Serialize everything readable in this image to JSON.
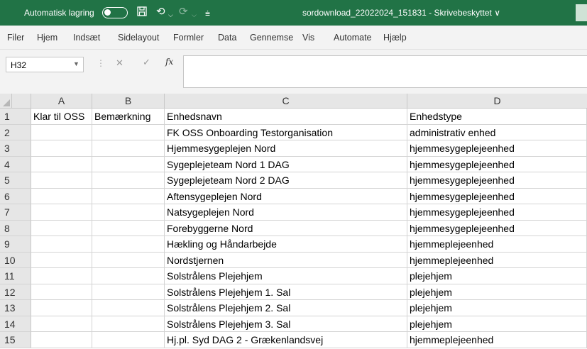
{
  "titlebar": {
    "autosave_label": "Automatisk lagring",
    "doc_title": "sordownload_22022024_151831 - Skrivebeskyttet ∨"
  },
  "menu": [
    "Filer",
    "Hjem",
    "Indsæt",
    "Sidelayout",
    "Formler",
    "Data",
    "Gennemse",
    "Vis",
    "Automate",
    "Hjælp"
  ],
  "formula_bar": {
    "name_box": "H32",
    "fx": "fx",
    "content": ""
  },
  "sheet": {
    "columns": [
      "A",
      "B",
      "C",
      "D"
    ],
    "header_row": [
      "Klar til OSS",
      "Bemærkning",
      "Enhedsnavn",
      "Enhedstype"
    ],
    "rows": [
      {
        "num": "1",
        "a": "Klar til OSS",
        "b": "Bemærkning",
        "c": "Enhedsnavn",
        "d": "Enhedstype"
      },
      {
        "num": "2",
        "a": "",
        "b": "",
        "c": "FK OSS Onboarding Testorganisation",
        "d": "administrativ enhed"
      },
      {
        "num": "3",
        "a": "",
        "b": "",
        "c": "Hjemmesygeplejen Nord",
        "d": "hjemmesygeplejeenhed"
      },
      {
        "num": "4",
        "a": "",
        "b": "",
        "c": "Sygeplejeteam Nord 1 DAG",
        "d": "hjemmesygeplejeenhed"
      },
      {
        "num": "5",
        "a": "",
        "b": "",
        "c": "Sygeplejeteam Nord 2 DAG",
        "d": "hjemmesygeplejeenhed"
      },
      {
        "num": "6",
        "a": "",
        "b": "",
        "c": "Aftensygeplejen Nord",
        "d": "hjemmesygeplejeenhed"
      },
      {
        "num": "7",
        "a": "",
        "b": "",
        "c": "Natsygeplejen Nord",
        "d": "hjemmesygeplejeenhed"
      },
      {
        "num": "8",
        "a": "",
        "b": "",
        "c": "Forebyggerne Nord",
        "d": "hjemmesygeplejeenhed"
      },
      {
        "num": "9",
        "a": "",
        "b": "",
        "c": "Hækling og Håndarbejde",
        "d": "hjemmeplejeenhed"
      },
      {
        "num": "10",
        "a": "",
        "b": "",
        "c": "Nordstjernen",
        "d": "hjemmeplejeenhed"
      },
      {
        "num": "11",
        "a": "",
        "b": "",
        "c": "Solstrålens Plejehjem",
        "d": "plejehjem"
      },
      {
        "num": "12",
        "a": "",
        "b": "",
        "c": "Solstrålens Plejehjem 1. Sal",
        "d": "plejehjem"
      },
      {
        "num": "13",
        "a": "",
        "b": "",
        "c": "Solstrålens Plejehjem 2. Sal",
        "d": "plejehjem"
      },
      {
        "num": "14",
        "a": "",
        "b": "",
        "c": "Solstrålens Plejehjem 3. Sal",
        "d": "plejehjem"
      },
      {
        "num": "15",
        "a": "",
        "b": "",
        "c": "Hj.pl. Syd DAG 2 - Grækenlandsvej",
        "d": "hjemmeplejeenhed"
      }
    ]
  },
  "colors": {
    "excel_green": "#217346",
    "header_gray": "#e6e6e6",
    "grid": "#d4d4d4"
  }
}
